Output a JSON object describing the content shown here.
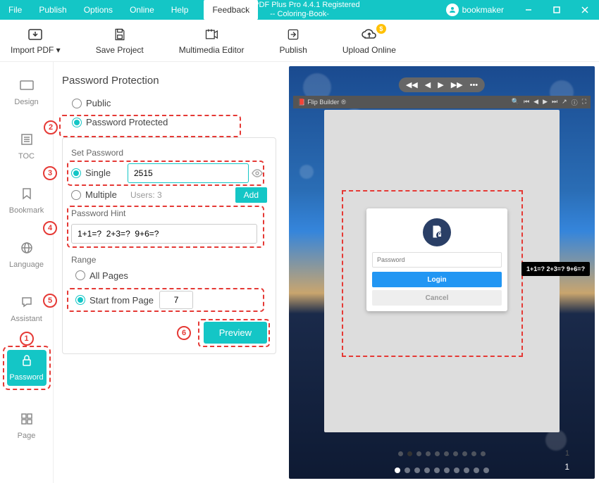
{
  "menus": {
    "file": "File",
    "publish": "Publish",
    "options": "Options",
    "online": "Online",
    "help": "Help",
    "feedback": "Feedback"
  },
  "title_line1": "Flip PDF Plus Pro 4.4.1 Registered",
  "title_line2": "-- Coloring-Book-",
  "username": "bookmaker",
  "toolbar": {
    "import": "Import PDF ▾",
    "save": "Save Project",
    "multimedia": "Multimedia Editor",
    "publish": "Publish",
    "upload": "Upload Online"
  },
  "tabs": {
    "design": "Design",
    "toc": "TOC",
    "bookmark": "Bookmark",
    "language": "Language",
    "assistant": "Assistant",
    "password": "Password",
    "page": "Page"
  },
  "panel": {
    "title": "Password Protection",
    "public": "Public",
    "protected": "Password Protected",
    "set_password": "Set Password",
    "single": "Single",
    "single_value": "2515",
    "multiple": "Multiple",
    "users": "Users: 3",
    "add": "Add",
    "hint_label": "Password Hint",
    "hint_value": "1+1=?  2+3=?  9+6=?",
    "range": "Range",
    "all_pages": "All Pages",
    "start_from": "Start from Page",
    "start_value": "7",
    "preview": "Preview"
  },
  "preview": {
    "logo": "Flip Builder",
    "login_placeholder": "Password",
    "login": "Login",
    "cancel": "Cancel",
    "tooltip": "1+1=?  2+3=?  9+6=?",
    "page_num": "1"
  },
  "annotations": {
    "n1": "1",
    "n2": "2",
    "n3": "3",
    "n4": "4",
    "n5": "5",
    "n6": "6"
  }
}
